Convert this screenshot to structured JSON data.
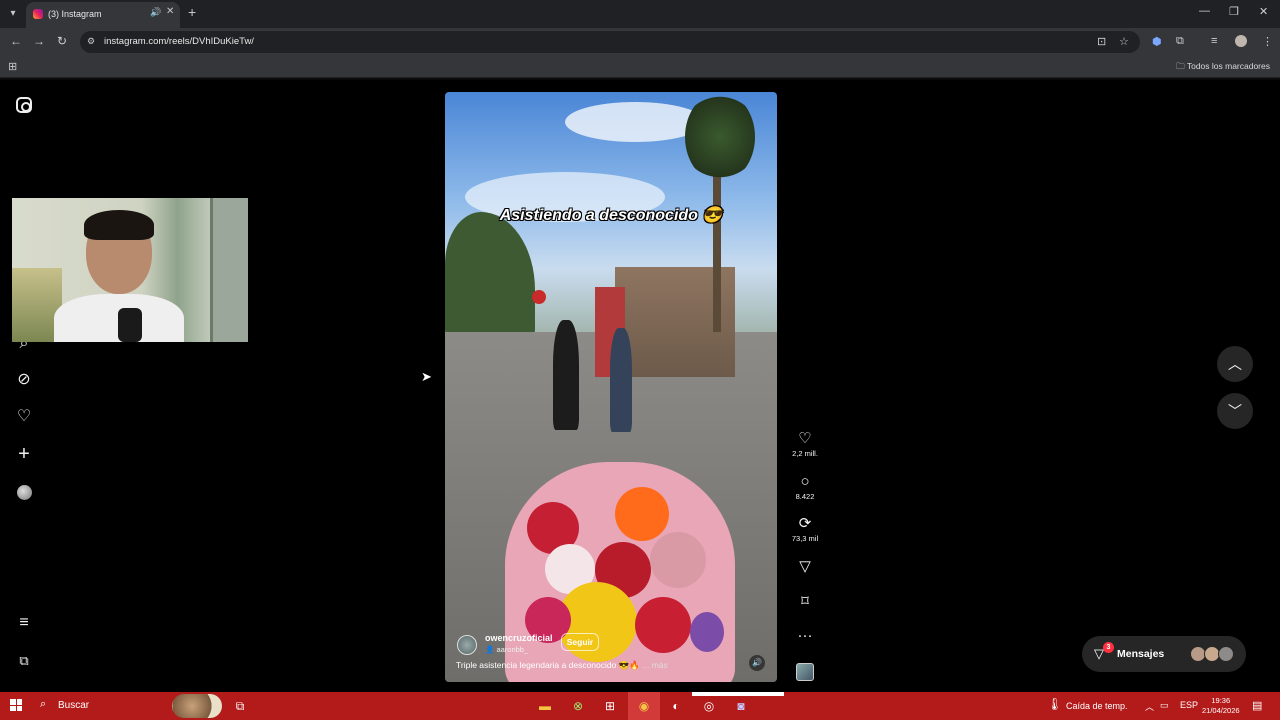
{
  "browser": {
    "tab_title": "(3) Instagram",
    "url": "instagram.com/reels/DVhIDuKieTw/",
    "bookmarks_folder": "Todos los marcadores"
  },
  "reel": {
    "overlay_text": "Asistiendo a desconocido 😎",
    "author": "owencruzoficial",
    "follow_label": "Seguir",
    "collab": "aaronbb_",
    "description": "Triple asistencia legendaria a desconocido 😎🔥",
    "more_label": "... más",
    "likes": "2,2 mill.",
    "comments": "8.422",
    "reposts": "73,3 mil"
  },
  "messages": {
    "label": "Mensajes",
    "badge": "3"
  },
  "taskbar": {
    "search_label": "Buscar",
    "weather": "Caída de temp.",
    "lang": "ESP",
    "time": "19:36",
    "date": "21/04/2026"
  },
  "icons": {
    "instagram": "instagram-icon",
    "search": "search-icon",
    "explore": "compass-icon",
    "notifications": "heart-icon",
    "create": "plus-icon",
    "menu": "hamburger-icon",
    "meta": "meta-icon"
  }
}
